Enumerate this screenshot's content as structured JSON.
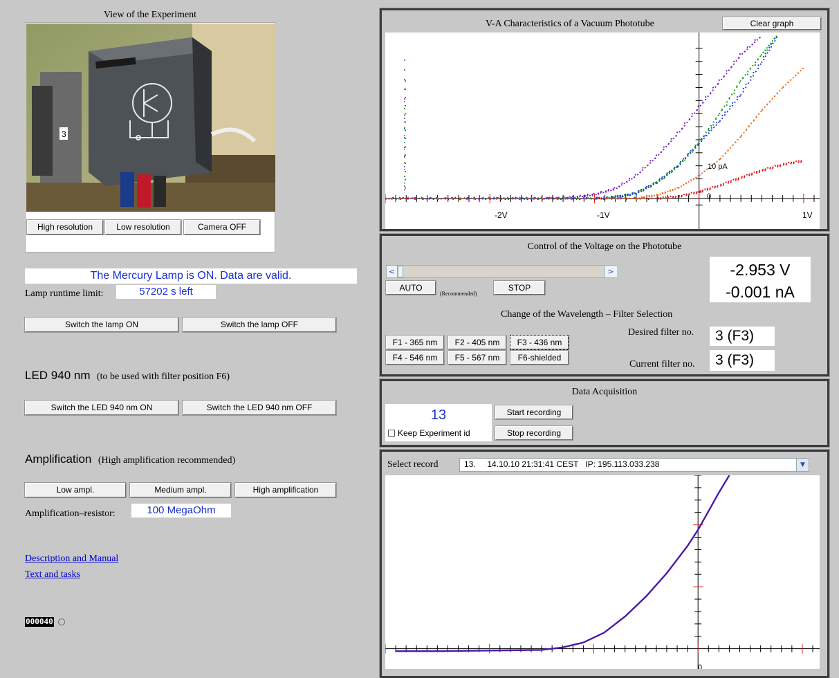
{
  "camera": {
    "title": "View of the Experiment",
    "buttons": [
      "High resolution",
      "Low resolution",
      "Camera OFF"
    ]
  },
  "lamp": {
    "status": "The Mercury Lamp is ON.  Data are valid.",
    "runtime_label": "Lamp runtime limit:",
    "runtime_value": "57202 s left",
    "on_label": "Switch the lamp ON",
    "off_label": "Switch the lamp OFF"
  },
  "led": {
    "heading": "LED 940 nm",
    "note": "(to be used with filter position F6)",
    "on_label": "Switch the LED 940 nm ON",
    "off_label": "Switch the LED 940 nm OFF"
  },
  "amplification": {
    "heading": "Amplification",
    "note": "(High amplification recommended)",
    "buttons": [
      "Low ampl.",
      "Medium ampl.",
      "High amplification"
    ],
    "resistor_label": "Amplification–resistor:",
    "resistor_value": "100 MegaOhm"
  },
  "links": [
    "Description and Manual",
    "Text and tasks"
  ],
  "counter": "000040",
  "va_chart": {
    "title": "V-A Characteristics of a Vacuum Phototube",
    "clear_label": "Clear graph"
  },
  "voltage": {
    "title": "Control of the Voltage on the Phototube",
    "auto_label": "AUTO",
    "recommended": "(Recommended)",
    "stop_label": "STOP",
    "voltage_readout": "-2.953 V",
    "current_readout": "-0.001 nA",
    "slider_level": 0.0
  },
  "filters": {
    "title": "Change of the Wavelength – Filter Selection",
    "buttons": [
      "F1 - 365 nm",
      "F2 - 405 nm",
      "F3 - 436 nm",
      "F4 - 546 nm",
      "F5 - 567 nm",
      "F6-shielded"
    ],
    "desired_label": "Desired filter no.",
    "desired_value": "3 (F3)",
    "current_label": "Current filter no.",
    "current_value": "3 (F3)"
  },
  "acquisition": {
    "title": "Data Acquisition",
    "experiment_id": "13",
    "keep_label": "Keep Experiment id",
    "start_label": "Start recording",
    "stop_label": "Stop recording"
  },
  "record": {
    "label": "Select record",
    "selected": "13.     14.10.10 21:31:41 CEST   IP: 195.113.033.238"
  },
  "colors": {
    "accent_text": "#1a2fd0",
    "series_violet": "#7a1fc8",
    "series_green": "#16a016",
    "series_blue": "#1f3fd6",
    "series_orange": "#f06a1a",
    "series_red": "#e01a1a",
    "record_curve": "#4b1aa8"
  },
  "chart_data": [
    {
      "type": "scatter",
      "title": "",
      "xlabel": "",
      "ylabel": "",
      "tick_labels_x": [
        "-2V",
        "-1V",
        "1V",
        "0"
      ],
      "tick_label_y": "10 pA",
      "xlim": [
        -3.0,
        1.1
      ],
      "ylim": [
        -1.5,
        25
      ],
      "grid": false,
      "series": [
        {
          "color": "violet",
          "x": [
            -3.0,
            -2.5,
            -2.0,
            -1.5,
            -1.2,
            -1.0,
            -0.8,
            -0.6,
            -0.4,
            -0.2,
            0.0,
            0.2,
            0.4,
            0.6
          ],
          "y": [
            0,
            0,
            0,
            0,
            0.2,
            0.6,
            1.5,
            3.5,
            6.5,
            10,
            14,
            18,
            22,
            25
          ]
        },
        {
          "color": "green",
          "x": [
            -3.0,
            -2.0,
            -1.5,
            -1.0,
            -0.8,
            -0.6,
            -0.4,
            -0.2,
            0.0,
            0.2,
            0.4,
            0.6,
            0.75
          ],
          "y": [
            0,
            0,
            0,
            0,
            0.2,
            0.8,
            2.5,
            5,
            8.5,
            13,
            18,
            22,
            25
          ]
        },
        {
          "color": "blue",
          "x": [
            -3.0,
            -2.0,
            -1.5,
            -1.0,
            -0.8,
            -0.6,
            -0.4,
            -0.2,
            0.0,
            0.2,
            0.4,
            0.6,
            0.75
          ],
          "y": [
            0,
            0,
            0,
            0,
            0.2,
            0.8,
            2.5,
            5,
            8.5,
            12,
            16,
            21,
            25
          ]
        },
        {
          "color": "orange",
          "x": [
            -3.0,
            -2.0,
            -1.0,
            -0.6,
            -0.4,
            -0.2,
            0.0,
            0.2,
            0.4,
            0.6,
            0.8,
            1.0
          ],
          "y": [
            0,
            0,
            0,
            0,
            0.5,
            1.6,
            3.5,
            6,
            9.5,
            13.5,
            17,
            20
          ]
        },
        {
          "color": "red",
          "x": [
            -3.0,
            -2.0,
            -1.0,
            -0.4,
            -0.2,
            0.0,
            0.2,
            0.4,
            0.6,
            0.8,
            1.0
          ],
          "y": [
            0,
            0,
            0,
            0,
            0.3,
            1.0,
            2.0,
            3.2,
            4.3,
            5.2,
            5.8
          ]
        }
      ]
    },
    {
      "type": "line",
      "title": "",
      "xlabel": "",
      "ylabel": "",
      "tick_labels_x": [
        "0"
      ],
      "xlim": [
        -3.0,
        1.1
      ],
      "ylim": [
        -0.3,
        14
      ],
      "grid": false,
      "series": [
        {
          "color": "record_curve",
          "x": [
            -2.9,
            -2.5,
            -2.0,
            -1.5,
            -1.3,
            -1.1,
            -0.9,
            -0.7,
            -0.5,
            -0.3,
            -0.1,
            0.0,
            0.1,
            0.2,
            0.3
          ],
          "y": [
            -0.2,
            -0.2,
            -0.15,
            -0.1,
            0.1,
            0.5,
            1.3,
            2.6,
            4.2,
            6.1,
            8.3,
            9.6,
            11.1,
            12.6,
            14
          ]
        }
      ]
    }
  ]
}
